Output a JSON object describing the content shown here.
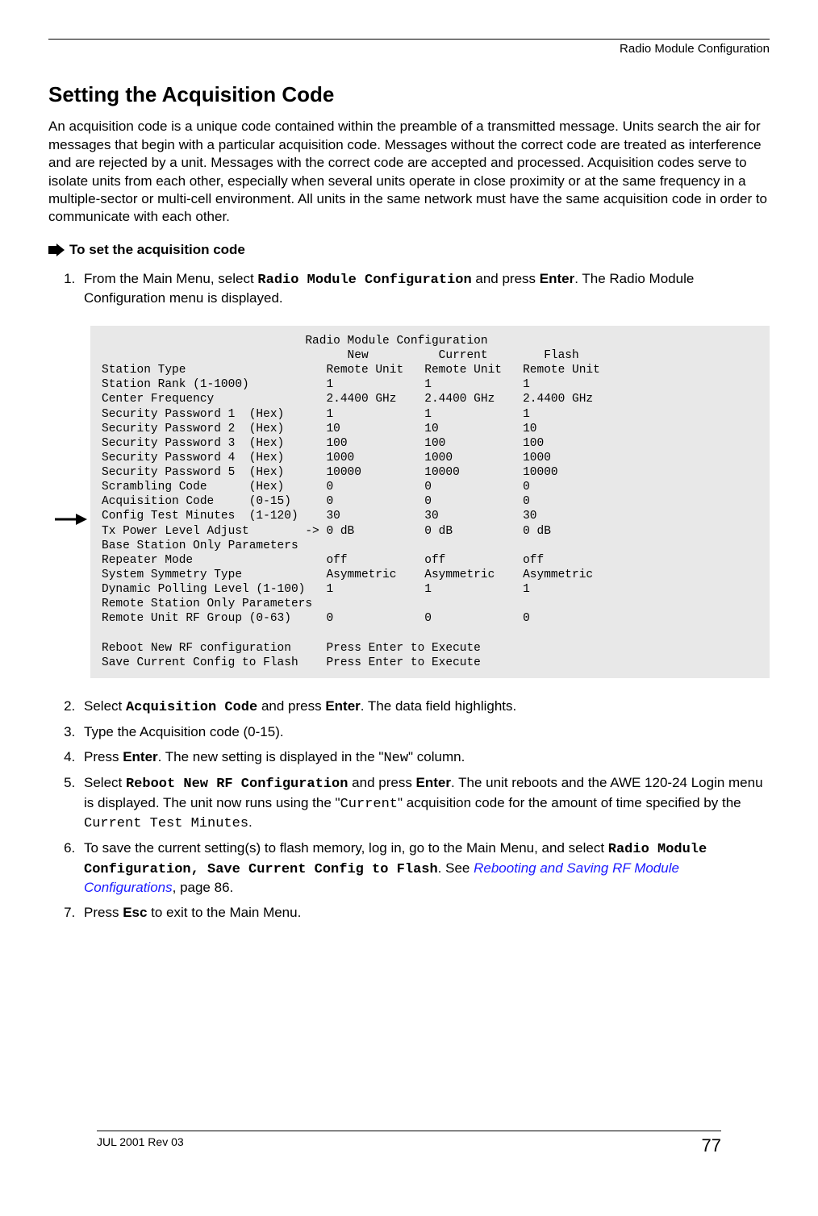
{
  "header": {
    "section": "Radio Module Configuration"
  },
  "title": "Setting the Acquisition Code",
  "intro": "An acquisition code is a unique code contained within the preamble of a transmitted message. Units search the air for messages that begin with a particular acquisition code. Messages without the correct code are treated as interference and are rejected by a unit. Messages with the correct code are accepted and processed. Acquisition codes serve to isolate units from each other, especially when several units operate in close proximity or at the same frequency in a multiple-sector or multi-cell environment. All units in the same network must have the same acquisition code in order to communicate with each other.",
  "task_heading": "To set the acquisition code",
  "steps": {
    "s1a": "From the Main Menu, select ",
    "s1cmd": "Radio Module Configuration",
    "s1b": " and press ",
    "s1key": "Enter",
    "s1c": ". The Radio Module Configuration menu is displayed.",
    "s2a": "Select ",
    "s2cmd": "Acquisition Code",
    "s2b": " and press ",
    "s2key": "Enter",
    "s2c": ". The data field highlights.",
    "s3": "Type the Acquisition code (0-15).",
    "s4a": "Press ",
    "s4key": "Enter",
    "s4b": ". The new setting is displayed in the \"",
    "s4col": "New",
    "s4c": "\" column.",
    "s5a": "Select ",
    "s5cmd": "Reboot New RF Configuration",
    "s5b": " and press ",
    "s5key": "Enter",
    "s5c": ". The unit reboots and the AWE 120-24 Login menu is displayed. The unit now runs using the \"",
    "s5col": "Current",
    "s5d": "\" acquisition code for the amount of time specified by the ",
    "s5field": "Current Test Minutes",
    "s5e": ".",
    "s6a": "To save the current setting(s) to flash memory, log in, go to the Main Menu, and select ",
    "s6cmd": "Radio Module Configuration, Save Current Config to Flash",
    "s6b": ". See ",
    "s6link": "Rebooting and Saving RF Module Configurations",
    "s6c": ", page 86.",
    "s7a": "Press ",
    "s7key": "Esc",
    "s7b": " to exit to the Main Menu."
  },
  "screen": "                             Radio Module Configuration\n                                   New          Current        Flash\nStation Type                    Remote Unit   Remote Unit   Remote Unit\nStation Rank (1-1000)           1             1             1\nCenter Frequency                2.4400 GHz    2.4400 GHz    2.4400 GHz\nSecurity Password 1  (Hex)      1             1             1\nSecurity Password 2  (Hex)      10            10            10\nSecurity Password 3  (Hex)      100           100           100\nSecurity Password 4  (Hex)      1000          1000          1000\nSecurity Password 5  (Hex)      10000         10000         10000\nScrambling Code      (Hex)      0             0             0\nAcquisition Code     (0-15)     0             0             0\nConfig Test Minutes  (1-120)    30            30            30\nTx Power Level Adjust        -> 0 dB          0 dB          0 dB\nBase Station Only Parameters\nRepeater Mode                   off           off           off\nSystem Symmetry Type            Asymmetric    Asymmetric    Asymmetric\nDynamic Polling Level (1-100)   1             1             1\nRemote Station Only Parameters\nRemote Unit RF Group (0-63)     0             0             0\n\nReboot New RF configuration     Press Enter to Execute\nSave Current Config to Flash    Press Enter to Execute",
  "footer": {
    "left": "JUL 2001 Rev 03",
    "page": "77"
  }
}
